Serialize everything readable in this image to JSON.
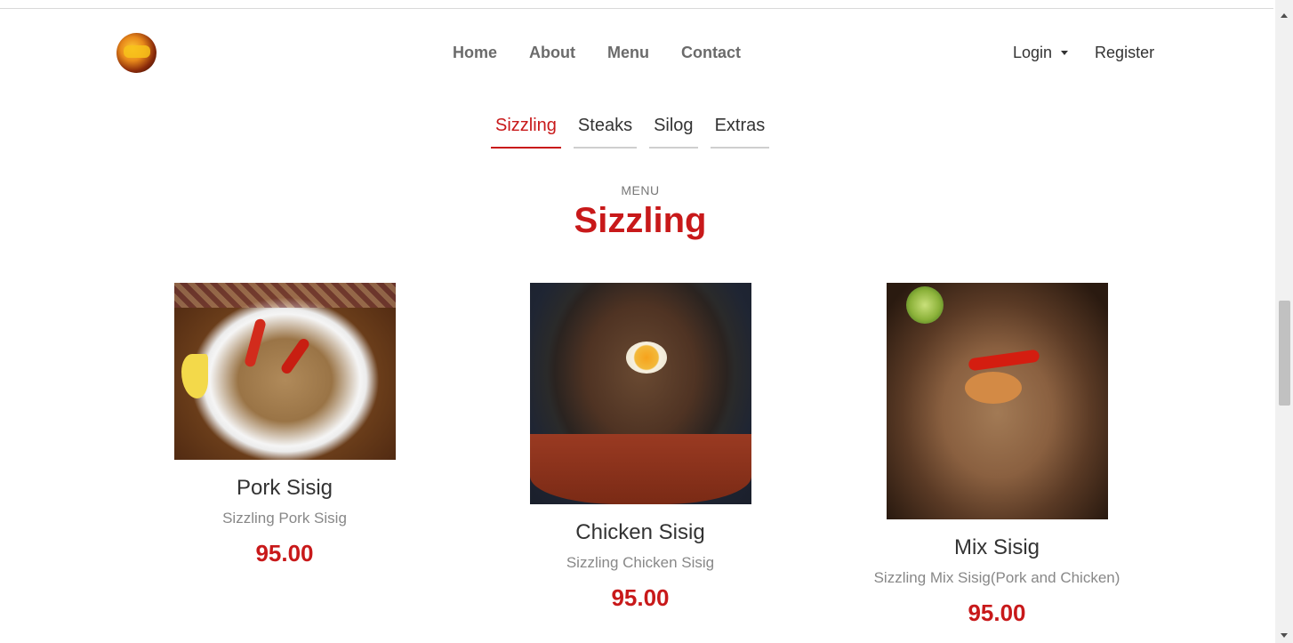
{
  "nav": {
    "links": [
      "Home",
      "About",
      "Menu",
      "Contact"
    ],
    "login": "Login",
    "register": "Register"
  },
  "tabs": [
    "Sizzling",
    "Steaks",
    "Silog",
    "Extras"
  ],
  "active_tab": "Sizzling",
  "section": {
    "label": "MENU",
    "title": "Sizzling"
  },
  "items": [
    {
      "name": "Pork Sisig",
      "description": "Sizzling Pork Sisig",
      "price": "95.00"
    },
    {
      "name": "Chicken Sisig",
      "description": "Sizzling Chicken Sisig",
      "price": "95.00"
    },
    {
      "name": "Mix Sisig",
      "description": "Sizzling Mix Sisig(Pork and Chicken)",
      "price": "95.00"
    }
  ],
  "colors": {
    "accent": "#c8191a",
    "nav_text": "#6b6b6b"
  }
}
